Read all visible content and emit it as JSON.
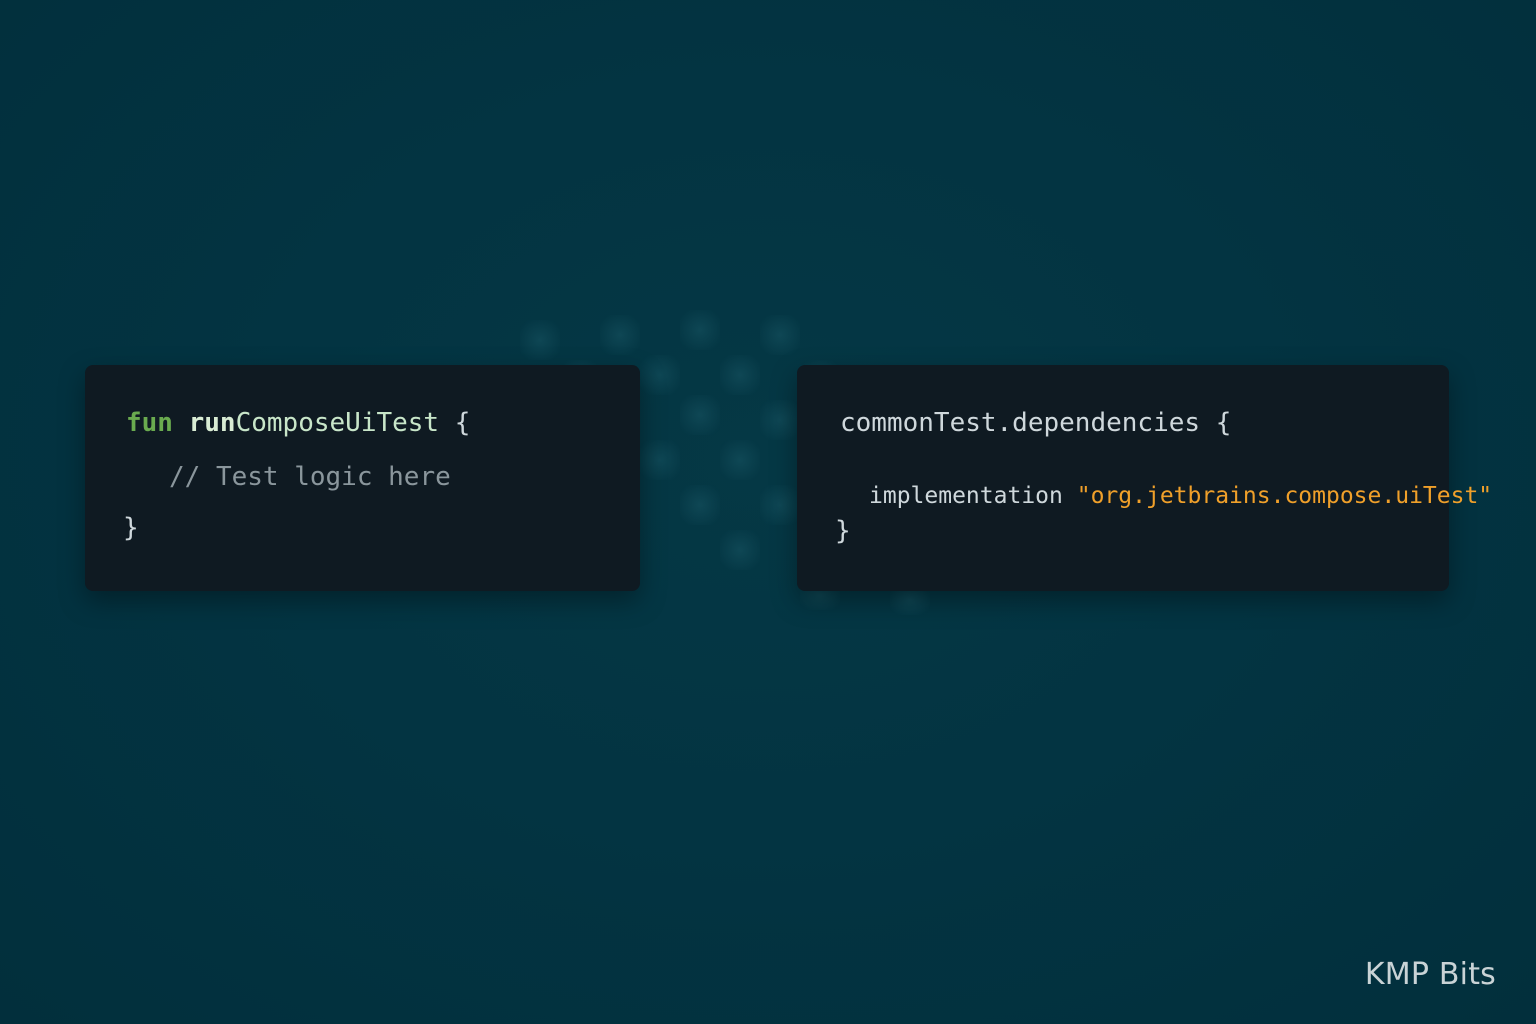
{
  "left_card": {
    "keyword": "fun",
    "fn_prefix": "run",
    "fn_rest": "ComposeUiTest",
    "open_brace": "{",
    "comment": "// Test logic here",
    "close_brace": "}"
  },
  "right_card": {
    "header": "commonTest.dependencies",
    "open_brace": "{",
    "impl_keyword": "implementation",
    "impl_string": "\"org.jetbrains.compose.uiTest\"",
    "close_brace": "}"
  },
  "watermark": "KMP Bits",
  "colors": {
    "background": "#033442",
    "card": "#0f1a22",
    "keyword": "#6aab4f",
    "string": "#f0a02a",
    "comment": "#8a969c"
  },
  "icons": {
    "background_decoration": "checkered-flag-icon"
  }
}
